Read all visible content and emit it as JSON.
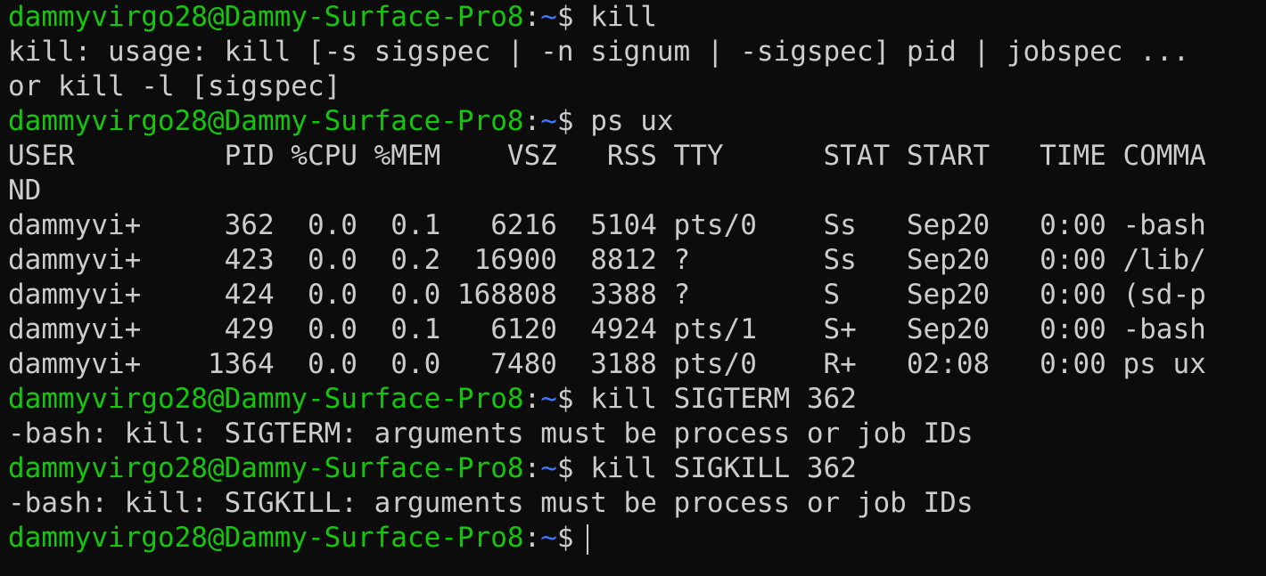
{
  "prompt": {
    "user_host": "dammyvirgo28@Dammy-Surface-Pro8",
    "separator": ":",
    "path": "~",
    "symbol": "$"
  },
  "lines": [
    {
      "type": "prompt",
      "command": " kill"
    },
    {
      "type": "output",
      "text": "kill: usage: kill [-s sigspec | -n signum | -sigspec] pid | jobspec ..."
    },
    {
      "type": "output",
      "text": "or kill -l [sigspec]"
    },
    {
      "type": "prompt",
      "command": " ps ux"
    },
    {
      "type": "output",
      "text": "USER         PID %CPU %MEM    VSZ   RSS TTY      STAT START   TIME COMMA"
    },
    {
      "type": "output",
      "text": "ND"
    },
    {
      "type": "output",
      "text": "dammyvi+     362  0.0  0.1   6216  5104 pts/0    Ss   Sep20   0:00 -bash"
    },
    {
      "type": "output",
      "text": "dammyvi+     423  0.0  0.2  16900  8812 ?        Ss   Sep20   0:00 /lib/"
    },
    {
      "type": "output",
      "text": "dammyvi+     424  0.0  0.0 168808  3388 ?        S    Sep20   0:00 (sd-p"
    },
    {
      "type": "output",
      "text": "dammyvi+     429  0.0  0.1   6120  4924 pts/1    S+   Sep20   0:00 -bash"
    },
    {
      "type": "output",
      "text": "dammyvi+    1364  0.0  0.0   7480  3188 pts/0    R+   02:08   0:00 ps ux"
    },
    {
      "type": "prompt",
      "command": " kill SIGTERM 362"
    },
    {
      "type": "output",
      "text": "-bash: kill: SIGTERM: arguments must be process or job IDs"
    },
    {
      "type": "prompt",
      "command": " kill SIGKILL 362"
    },
    {
      "type": "output",
      "text": "-bash: kill: SIGKILL: arguments must be process or job IDs"
    },
    {
      "type": "active",
      "command": ""
    }
  ],
  "colors": {
    "background": "#0c0c0c",
    "foreground": "#cccccc",
    "user_host": "#16c60c",
    "path": "#3b78ff"
  }
}
